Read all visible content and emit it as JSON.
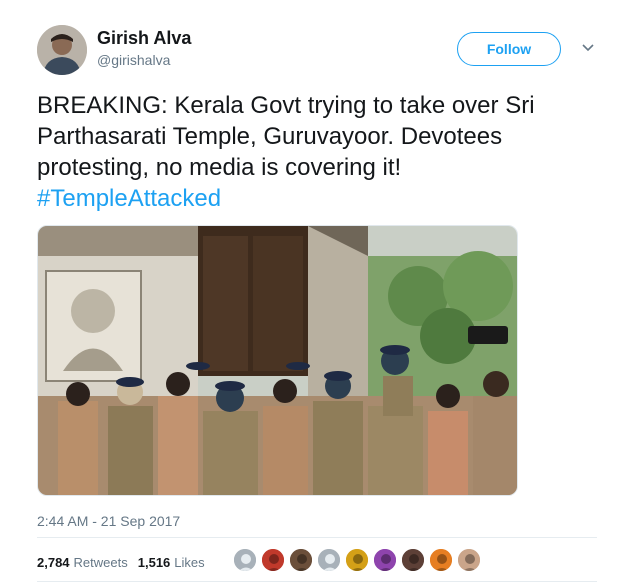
{
  "author": {
    "name": "Girish Alva",
    "handle": "@girishalva"
  },
  "follow_label": "Follow",
  "tweet": {
    "text": "BREAKING: Kerala Govt trying to take over Sri Parthasarati Temple, Guruvayoor. Devotees protesting, no media is covering it!",
    "hashtag": "#TempleAttacked",
    "timestamp": "2:44 AM - 21 Sep 2017"
  },
  "stats": {
    "retweets_count": "2,784",
    "retweets_label": "Retweets",
    "likes_count": "1,516",
    "likes_label": "Likes"
  },
  "icons": {
    "caret": "chevron-down-icon"
  },
  "colors": {
    "accent": "#1da1f2",
    "muted": "#657786",
    "text": "#14171a"
  },
  "likers": [
    {
      "color": "#a8b1b9",
      "kind": "default"
    },
    {
      "color": "#c0392b",
      "kind": "photo"
    },
    {
      "color": "#6b4f3a",
      "kind": "photo"
    },
    {
      "color": "#a8b1b9",
      "kind": "default"
    },
    {
      "color": "#d4a017",
      "kind": "photo"
    },
    {
      "color": "#8e44ad",
      "kind": "photo"
    },
    {
      "color": "#5d4037",
      "kind": "photo"
    },
    {
      "color": "#e67e22",
      "kind": "photo"
    },
    {
      "color": "#caa58a",
      "kind": "photo"
    }
  ]
}
